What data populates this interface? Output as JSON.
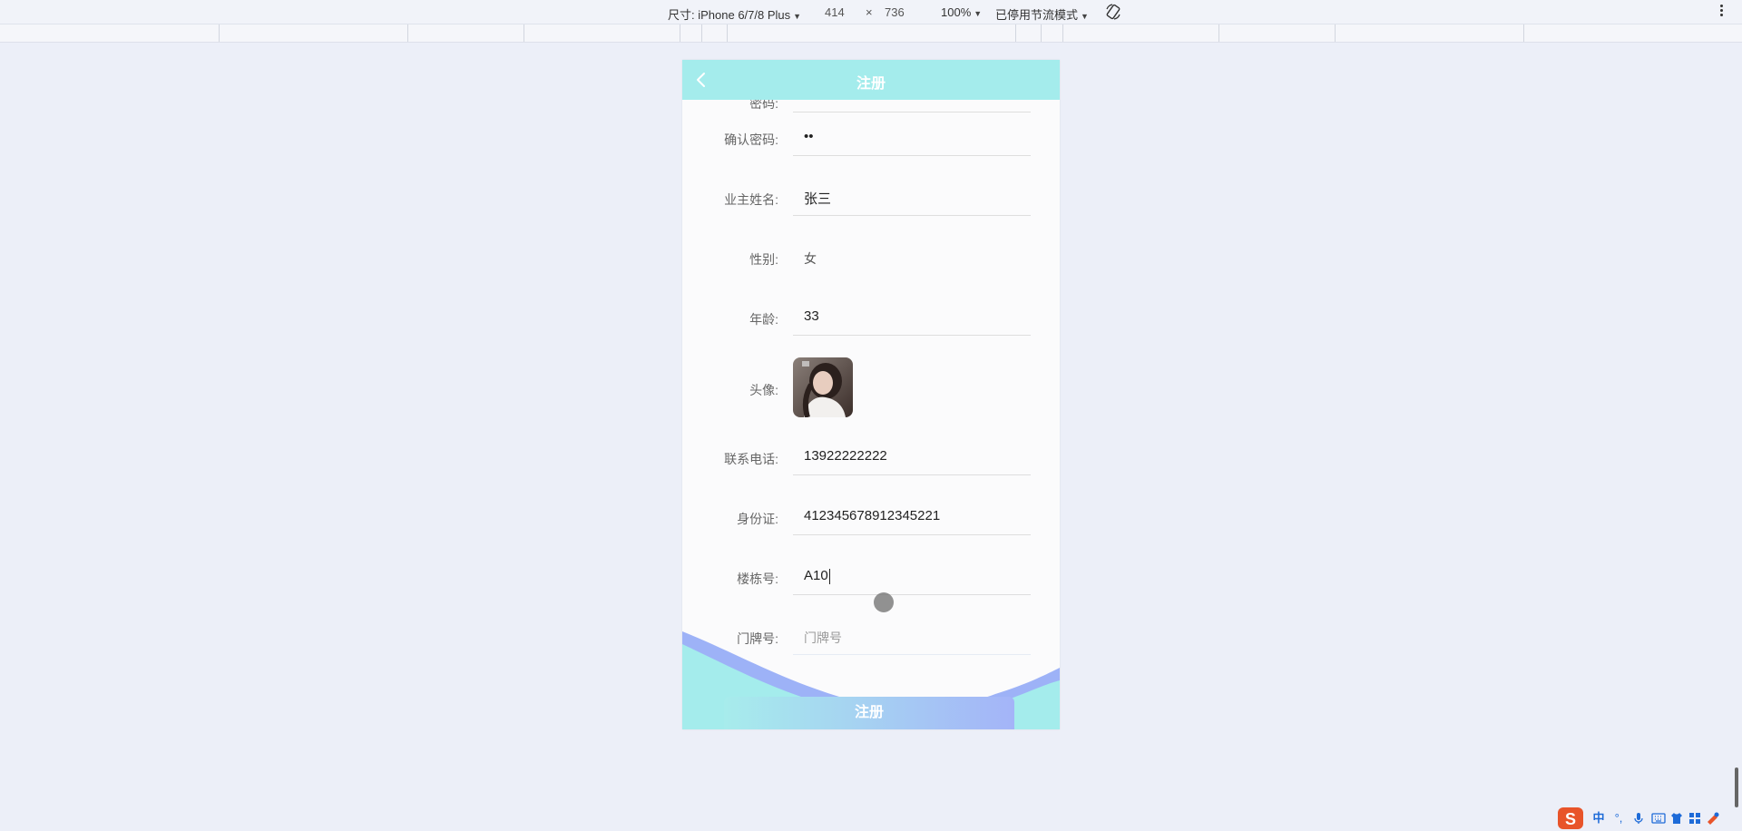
{
  "devtools": {
    "size_label": "尺寸: iPhone 6/7/8 Plus",
    "width_value": "414",
    "times_sign": "×",
    "height_value": "736",
    "zoom": "100%",
    "throttle": "已停用节流模式"
  },
  "app": {
    "title": "注册",
    "fields": [
      {
        "label": "密码:",
        "value": "",
        "placeholder": ""
      },
      {
        "label": "确认密码:",
        "value": "••",
        "placeholder": ""
      },
      {
        "label": "业主姓名:",
        "value": "张三",
        "placeholder": ""
      },
      {
        "label": "性别:",
        "value": "女",
        "placeholder": ""
      },
      {
        "label": "年龄:",
        "value": "33",
        "placeholder": ""
      },
      {
        "label": "头像:",
        "value": "",
        "placeholder": ""
      },
      {
        "label": "联系电话:",
        "value": "13922222222",
        "placeholder": ""
      },
      {
        "label": "身份证:",
        "value": "412345678912345221",
        "placeholder": ""
      },
      {
        "label": "楼栋号:",
        "value": "A10",
        "placeholder": ""
      },
      {
        "label": "门牌号:",
        "value": "",
        "placeholder": "门牌号"
      }
    ],
    "submit_label": "注册"
  },
  "tray": {
    "ime_mode": "中",
    "punct": "°,"
  },
  "colors": {
    "header": "#a4ecec",
    "button_start": "#a7ecec",
    "button_end": "#a4b4f8",
    "wave_blue": "#9db2f7",
    "wave_cyan": "#a4ecec"
  }
}
